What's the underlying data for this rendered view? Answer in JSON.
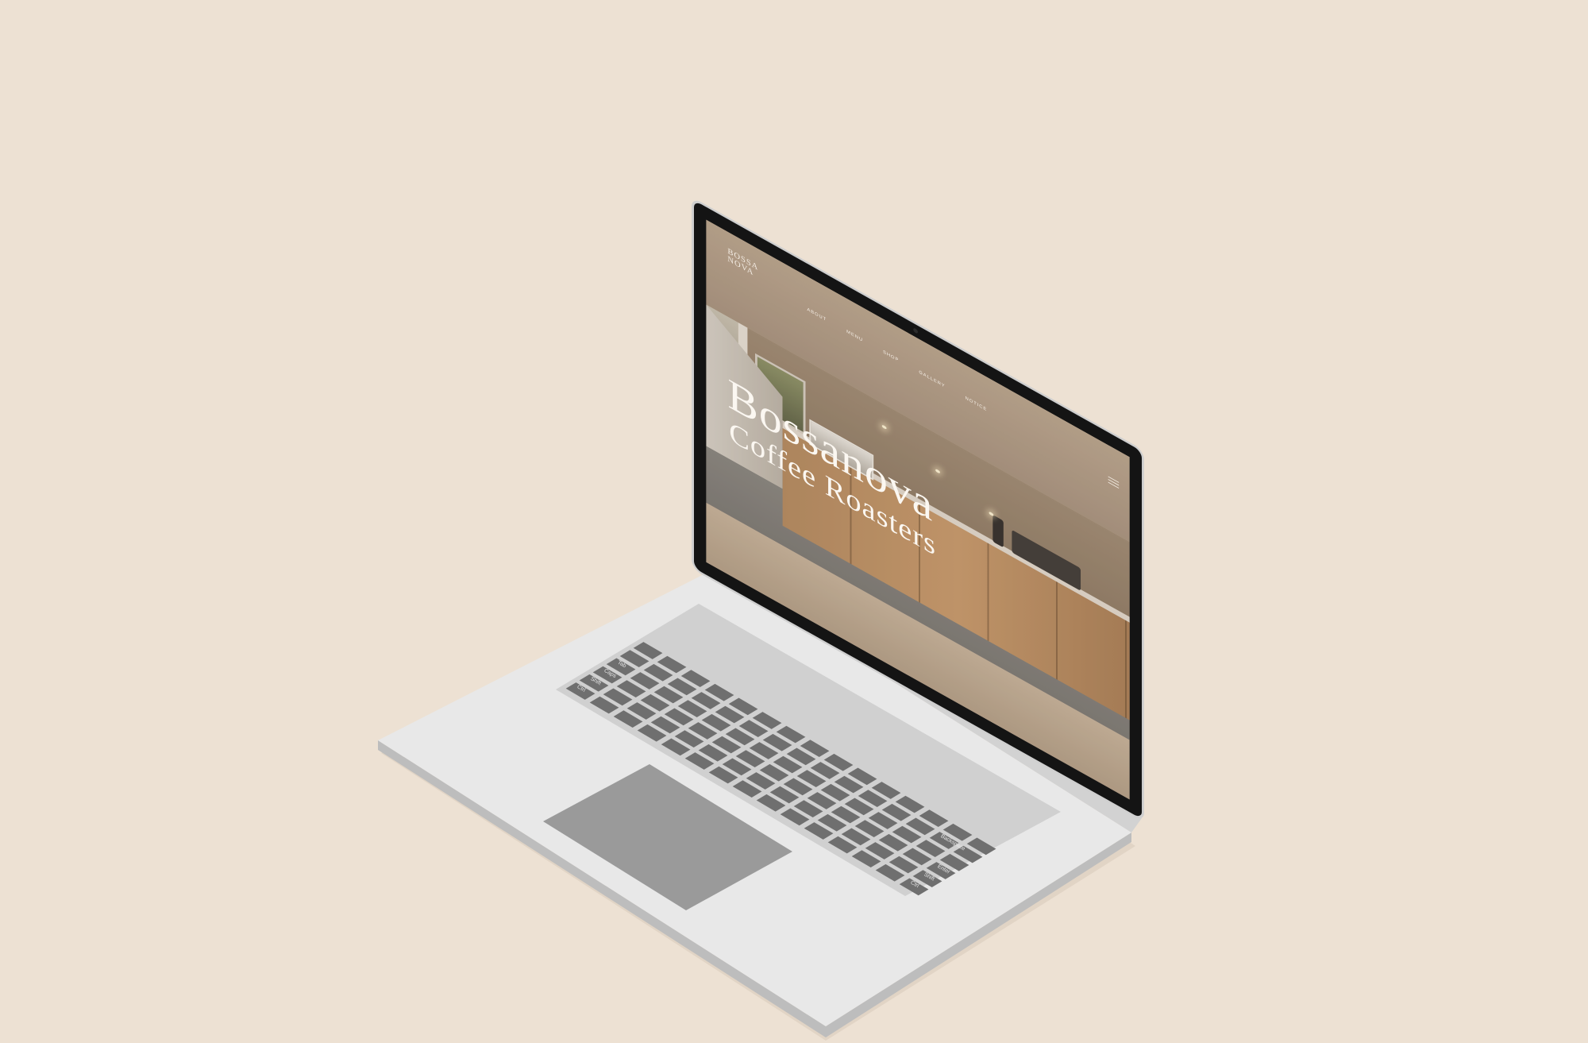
{
  "site": {
    "logo_line1": "BOSSA",
    "logo_line2": "NOVA",
    "nav": [
      "ABOUT",
      "MENU",
      "SHOP",
      "GALLERY",
      "NOTICE"
    ],
    "hero_line1": "Bossanova",
    "hero_line2": "Coffee Roasters"
  },
  "keyboard": {
    "labels": [
      "Ctrl",
      "Shift",
      "Caps",
      "Tab",
      "Backspace",
      "Enter",
      "Shift",
      "Ctrl"
    ]
  },
  "colors": {
    "background": "#ede1d3",
    "laptop_body": "#e6e6e6",
    "keys": "#6f6f6f",
    "trackpad": "#9a9a9a"
  }
}
